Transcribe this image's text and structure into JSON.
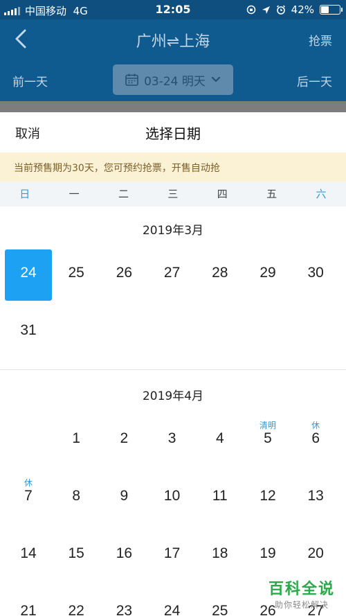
{
  "status_bar": {
    "carrier": "中国移动",
    "network": "4G",
    "time": "12:05",
    "battery": "42%",
    "battery_level": 0.42
  },
  "header": {
    "title": "广州⇌上海",
    "right_action": "抢票",
    "prev_day": "前一天",
    "next_day": "后一天",
    "selected_date": "03-24 明天"
  },
  "sheet": {
    "cancel": "取消",
    "title": "选择日期",
    "notice": "当前预售期为30天，您可预约抢票，开售自动抢",
    "weekdays": [
      "日",
      "一",
      "二",
      "三",
      "四",
      "五",
      "六"
    ]
  },
  "months": [
    {
      "title": "2019年3月",
      "days": [
        {
          "label": "24",
          "col": 0,
          "row": 0,
          "selected": true
        },
        {
          "label": "25",
          "col": 1,
          "row": 0
        },
        {
          "label": "26",
          "col": 2,
          "row": 0
        },
        {
          "label": "27",
          "col": 3,
          "row": 0
        },
        {
          "label": "28",
          "col": 4,
          "row": 0
        },
        {
          "label": "29",
          "col": 5,
          "row": 0
        },
        {
          "label": "30",
          "col": 6,
          "row": 0
        },
        {
          "label": "31",
          "col": 0,
          "row": 1
        }
      ]
    },
    {
      "title": "2019年4月",
      "days": [
        {
          "label": "1",
          "col": 1,
          "row": 0
        },
        {
          "label": "2",
          "col": 2,
          "row": 0
        },
        {
          "label": "3",
          "col": 3,
          "row": 0
        },
        {
          "label": "4",
          "col": 4,
          "row": 0
        },
        {
          "label": "5",
          "col": 5,
          "row": 0,
          "tag": "清明"
        },
        {
          "label": "6",
          "col": 6,
          "row": 0,
          "tag": "休"
        },
        {
          "label": "7",
          "col": 0,
          "row": 1,
          "tag": "休"
        },
        {
          "label": "8",
          "col": 1,
          "row": 1
        },
        {
          "label": "9",
          "col": 2,
          "row": 1
        },
        {
          "label": "10",
          "col": 3,
          "row": 1
        },
        {
          "label": "11",
          "col": 4,
          "row": 1
        },
        {
          "label": "12",
          "col": 5,
          "row": 1
        },
        {
          "label": "13",
          "col": 6,
          "row": 1
        },
        {
          "label": "14",
          "col": 0,
          "row": 2
        },
        {
          "label": "15",
          "col": 1,
          "row": 2
        },
        {
          "label": "16",
          "col": 2,
          "row": 2
        },
        {
          "label": "17",
          "col": 3,
          "row": 2
        },
        {
          "label": "18",
          "col": 4,
          "row": 2
        },
        {
          "label": "19",
          "col": 5,
          "row": 2
        },
        {
          "label": "20",
          "col": 6,
          "row": 2
        },
        {
          "label": "21",
          "col": 0,
          "row": 3
        },
        {
          "label": "22",
          "col": 1,
          "row": 3
        },
        {
          "label": "23",
          "col": 2,
          "row": 3
        },
        {
          "label": "24",
          "col": 3,
          "row": 3
        },
        {
          "label": "25",
          "col": 4,
          "row": 3
        },
        {
          "label": "26",
          "col": 5,
          "row": 3
        },
        {
          "label": "27",
          "col": 6,
          "row": 3
        }
      ]
    }
  ],
  "watermark": {
    "main": "百科全说",
    "sub": "助你轻松解决"
  },
  "colors": {
    "header_bg": "#0f5a8f",
    "accent": "#1da1f2",
    "holiday": "#2e9ad6",
    "notice_bg": "#fbf1d4"
  }
}
